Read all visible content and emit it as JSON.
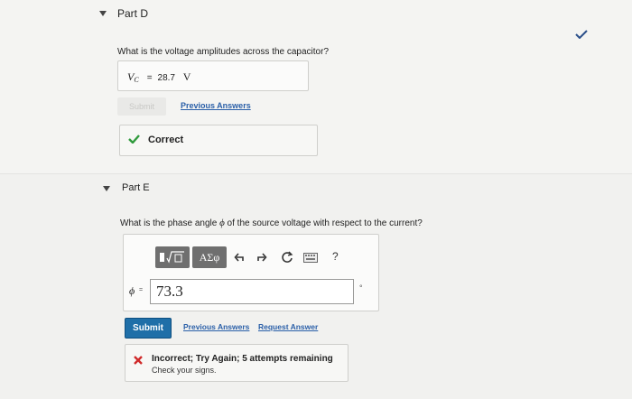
{
  "colors": {
    "link": "#2a5fa8",
    "correct": "#2f9a3c",
    "incorrect": "#d02a2a",
    "submit": "#1f6fa8"
  },
  "part_d": {
    "title": "Part D",
    "question": "What is the voltage amplitudes across the capacitor?",
    "answer": {
      "variable": "V",
      "subscript": "C",
      "equals": "=",
      "value": "28.7",
      "unit": "V"
    },
    "submit_label": "Submit",
    "previous_answers_label": "Previous Answers",
    "feedback": "Correct",
    "status_icon": "check-icon"
  },
  "part_e": {
    "title": "Part E",
    "question_pre": "What is the phase angle ",
    "question_symbol": "ϕ",
    "question_post": " of the source voltage with respect to the current?",
    "toolbar": {
      "templates_icon": "templates-icon",
      "greek_label": "ΑΣφ",
      "undo_icon": "undo-icon",
      "redo_icon": "redo-icon",
      "reset_icon": "reset-icon",
      "keyboard_icon": "keyboard-icon",
      "help_label": "?"
    },
    "input_label": "ϕ",
    "input_value": "73.3",
    "unit": "°",
    "submit_label": "Submit",
    "previous_answers_label": "Previous Answers",
    "request_answer_label": "Request Answer",
    "feedback_title": "Incorrect; Try Again; 5 attempts remaining",
    "feedback_sub": "Check your signs."
  }
}
